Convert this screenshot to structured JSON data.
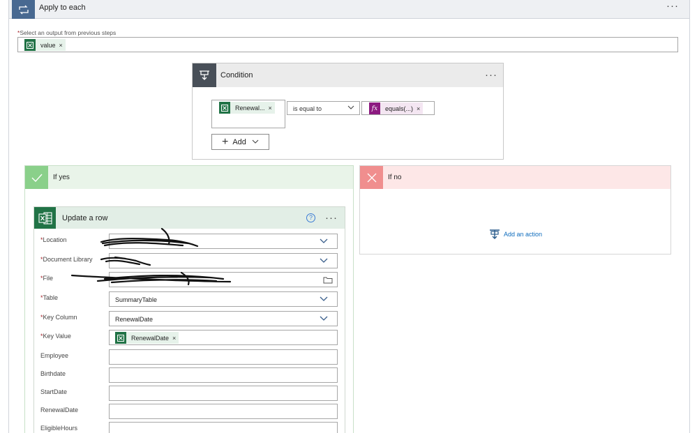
{
  "apply_to_each": {
    "title": "Apply to each",
    "select_label": "Select an output from previous steps",
    "token": "value",
    "colors": {
      "header_icon": "#486991"
    }
  },
  "condition": {
    "title": "Condition",
    "left_token": "Renewal...",
    "operator": "is equal to",
    "right_token": "equals(...)",
    "add_label": "Add",
    "fx_glyph": "fx"
  },
  "if_yes": {
    "title": "If yes",
    "color": "#8ad08a"
  },
  "if_no": {
    "title": "If no",
    "add_action_label": "Add an action",
    "color": "#f08e8e"
  },
  "update_row": {
    "title": "Update a row",
    "help": "?",
    "fields": [
      {
        "label": "Location",
        "required": true,
        "value": "",
        "kind": "dropdown",
        "redacted": true
      },
      {
        "label": "Document Library",
        "required": true,
        "value": "",
        "kind": "dropdown",
        "redacted": true
      },
      {
        "label": "File",
        "required": true,
        "value": "",
        "kind": "file",
        "redacted": true
      },
      {
        "label": "Table",
        "required": true,
        "value": "SummaryTable",
        "kind": "dropdown"
      },
      {
        "label": "Key Column",
        "required": true,
        "value": "RenewalDate",
        "kind": "dropdown"
      },
      {
        "label": "Key Value",
        "required": true,
        "value": "RenewalDate",
        "kind": "token"
      },
      {
        "label": "Employee",
        "required": false,
        "value": "",
        "kind": "text"
      },
      {
        "label": "Birthdate",
        "required": false,
        "value": "",
        "kind": "text"
      },
      {
        "label": "StartDate",
        "required": false,
        "value": "",
        "kind": "text"
      },
      {
        "label": "RenewalDate",
        "required": false,
        "value": "",
        "kind": "text"
      },
      {
        "label": "EligibleHours",
        "required": false,
        "value": "",
        "kind": "text"
      }
    ]
  },
  "icons": {
    "loop": "loop-icon",
    "condition": "condition-icon",
    "check": "check-icon",
    "cross": "close-icon",
    "excel": "excel-icon",
    "more": "more-options-icon",
    "help": "help-icon",
    "chevron": "chevron-down-icon",
    "folder": "folder-icon",
    "add_action": "add-action-icon"
  }
}
